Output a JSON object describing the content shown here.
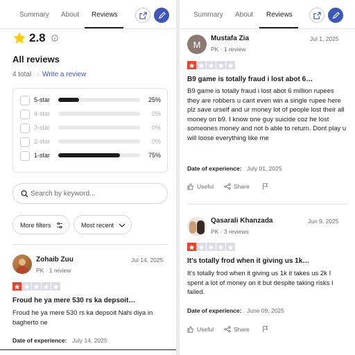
{
  "tabs": {
    "summary": "Summary",
    "about": "About",
    "reviews": "Reviews"
  },
  "overview": {
    "rating": "2.8",
    "heading": "All reviews",
    "total": "4 total",
    "dot": "·",
    "write_review": "Write a review",
    "distribution": [
      {
        "label": "5-star",
        "percent_text": "25%",
        "fill_fraction": 0.25,
        "active": true
      },
      {
        "label": "4-star",
        "percent_text": "0%",
        "fill_fraction": 0,
        "active": false
      },
      {
        "label": "3-star",
        "percent_text": "0%",
        "fill_fraction": 0,
        "active": false
      },
      {
        "label": "2-star",
        "percent_text": "0%",
        "fill_fraction": 0,
        "active": false
      },
      {
        "label": "1-star",
        "percent_text": "75%",
        "fill_fraction": 0.75,
        "active": true
      }
    ],
    "search_placeholder": "Search by keyword...",
    "more_filters": "More filters",
    "sort": "Most recent"
  },
  "reviews": [
    {
      "name": "Zohaib Zuu",
      "meta": "PK · 1 review",
      "date": "Jul 14, 2025",
      "stars": 1,
      "title": "Froud he ya mere 530 rs ka depsoit…",
      "body": "Froud he ya mere 530 rs ka depsoit Nahi diya in bagherto ne",
      "experience_label": "Date of experience:",
      "experience_date": "July 14, 2025"
    },
    {
      "name": "Mustafa Zia",
      "avatar_letter": "M",
      "meta": "PK · 1 review",
      "date": "Jul 1, 2025",
      "stars": 1,
      "title": "B9 game is totally fraud i lost abot 6…",
      "body": "B9 game is totally fraud i lost abot 6 million rupees they are robbers u cant even win a single rupee here plz save urself and ur money lot of people lost their all money on b9. I know one guy suicide coz he lost someones money and not b able to return. Dont play u will loose everything like me",
      "experience_label": "Date of experience:",
      "experience_date": "July 01, 2025",
      "useful": "Useful",
      "share": "Share"
    },
    {
      "name": "Qasarali Khanzada",
      "meta": "PK · 3 reviews",
      "date": "Jun 9, 2025",
      "stars": 1,
      "title": "It's totally frod when it giving us 1k…",
      "body": "It's totally frod when it giving us 1k it takes us 2k I spent a lot of money on it but despite taking risks I failed.",
      "experience_label": "Date of experience:",
      "experience_date": "June 09, 2025",
      "useful": "Useful",
      "share": "Share"
    }
  ],
  "colors": {
    "accent": "#3c57bc",
    "star_red": "#e8432e",
    "star_gray": "#dcdce6",
    "overall_star": "#ffcc00"
  }
}
